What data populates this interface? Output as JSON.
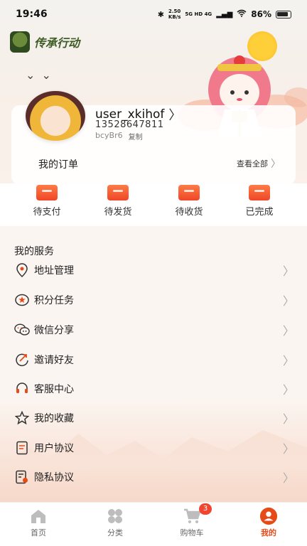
{
  "status_bar": {
    "time": "19:46",
    "net_speed": "2.50",
    "net_unit": "KB/s",
    "network_tags": "5G HD 4G",
    "battery": "86%"
  },
  "logo": {
    "text": "传承行动"
  },
  "profile": {
    "username": "user_xkihof",
    "phone": "13528647811",
    "uid": "bcyBr6",
    "copy_label": "复制"
  },
  "orders": {
    "title": "我的订单",
    "view_all": "查看全部",
    "items": [
      {
        "label": "待支付",
        "icon": "wallet-icon"
      },
      {
        "label": "待发货",
        "icon": "box-icon"
      },
      {
        "label": "待收货",
        "icon": "truck-icon"
      },
      {
        "label": "已完成",
        "icon": "return-icon"
      }
    ]
  },
  "services": {
    "title": "我的服务",
    "items": [
      {
        "label": "地址管理",
        "icon": "location-icon"
      },
      {
        "label": "积分任务",
        "icon": "points-star-icon"
      },
      {
        "label": "微信分享",
        "icon": "wechat-icon"
      },
      {
        "label": "邀请好友",
        "icon": "invite-icon"
      },
      {
        "label": "客服中心",
        "icon": "headset-icon"
      },
      {
        "label": "我的收藏",
        "icon": "star-icon"
      },
      {
        "label": "用户协议",
        "icon": "document-icon"
      },
      {
        "label": "隐私协议",
        "icon": "privacy-doc-icon"
      }
    ]
  },
  "bottom_nav": {
    "items": [
      {
        "label": "首页",
        "icon": "home-icon"
      },
      {
        "label": "分类",
        "icon": "category-icon"
      },
      {
        "label": "购物车",
        "icon": "cart-icon"
      },
      {
        "label": "我的",
        "icon": "profile-icon"
      }
    ],
    "cart_badge": "3",
    "active": "我的"
  },
  "colors": {
    "accent": "#e64a19",
    "order_icon": "#f05a2e",
    "badge": "#f04630"
  }
}
